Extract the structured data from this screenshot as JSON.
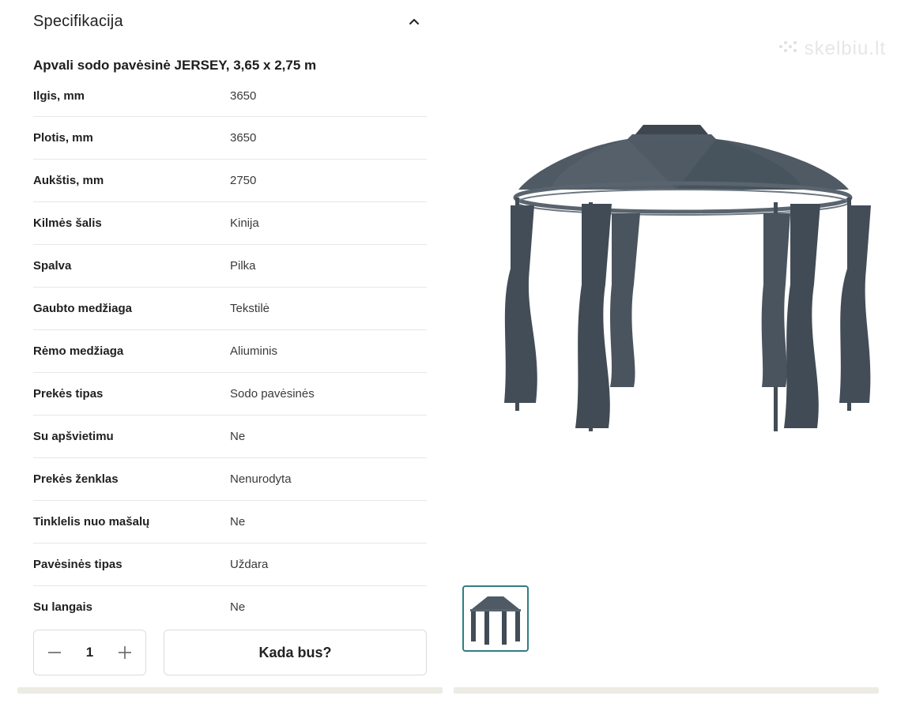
{
  "spec": {
    "title": "Specifikacija",
    "collapse_icon": "chevron-up-icon",
    "product_name": "Apvali sodo pavėsinė JERSEY, 3,65 x 2,75 m",
    "rows": [
      {
        "label": "Ilgis, mm",
        "value": "3650"
      },
      {
        "label": "Plotis, mm",
        "value": "3650"
      },
      {
        "label": "Aukštis, mm",
        "value": "2750"
      },
      {
        "label": "Kilmės šalis",
        "value": "Kinija"
      },
      {
        "label": "Spalva",
        "value": "Pilka"
      },
      {
        "label": "Gaubto medžiaga",
        "value": "Tekstilė"
      },
      {
        "label": "Rėmo medžiaga",
        "value": "Aliuminis"
      },
      {
        "label": "Prekės tipas",
        "value": "Sodo pavėsinės"
      },
      {
        "label": "Su apšvietimu",
        "value": "Ne"
      },
      {
        "label": "Prekės ženklas",
        "value": "Nenurodyta"
      },
      {
        "label": "Tinklelis nuo mašalų",
        "value": "Ne"
      },
      {
        "label": "Pavėsinės tipas",
        "value": "Uždara"
      },
      {
        "label": "Su langais",
        "value": "Ne"
      }
    ]
  },
  "quantity": {
    "value": "1",
    "minus_icon": "minus-icon",
    "plus_icon": "plus-icon"
  },
  "cta": {
    "label": "Kada bus?"
  },
  "watermark": {
    "text": "skelbiu.lt"
  },
  "colors": {
    "thumbnail_border": "#2f7f82",
    "gazebo": "#4a5560",
    "divider": "#e7e7e7"
  }
}
